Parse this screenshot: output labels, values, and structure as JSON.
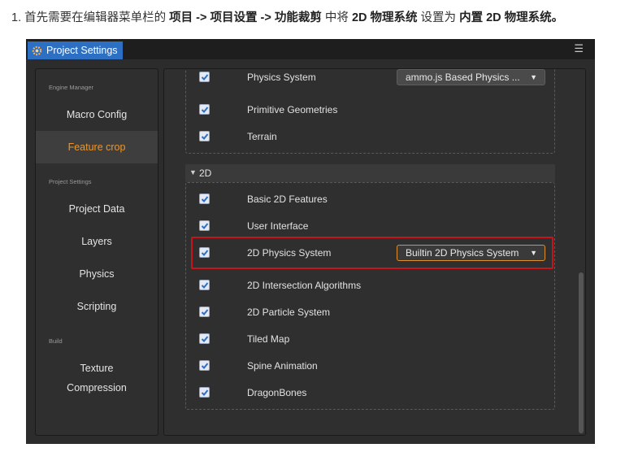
{
  "instruction": {
    "prefix": "1. 首先需要在编辑器菜单栏的 ",
    "menu_path": "项目 -> 项目设置 -> 功能裁剪",
    "middle": " 中将 ",
    "target": "2D 物理系统",
    "middle2": " 设置为 ",
    "value": "内置 2D 物理系统。"
  },
  "window": {
    "title": "Project Settings",
    "menu_icon": "hamburger-menu-icon"
  },
  "sidebar": {
    "engine_manager_header": "Engine Manager",
    "project_settings_header": "Project Settings",
    "build_header": "Build",
    "items": {
      "macro_config": "Macro Config",
      "feature_crop": "Feature crop",
      "project_data": "Project Data",
      "layers": "Layers",
      "physics": "Physics",
      "scripting": "Scripting",
      "texture": "Texture",
      "compression": "Compression"
    }
  },
  "features_3d": [
    {
      "label": "Physics System",
      "checked": true,
      "select": "ammo.js Based Physics ..."
    },
    {
      "label": "Primitive Geometries",
      "checked": true
    },
    {
      "label": "Terrain",
      "checked": true
    }
  ],
  "section_2d": {
    "label": "2D",
    "expanded": true
  },
  "features_2d": [
    {
      "label": "Basic 2D Features",
      "checked": true
    },
    {
      "label": "User Interface",
      "checked": true
    },
    {
      "label": "2D Physics System",
      "checked": true,
      "select": "Builtin 2D Physics System"
    },
    {
      "label": "2D Intersection Algorithms",
      "checked": true
    },
    {
      "label": "2D Particle System",
      "checked": true
    },
    {
      "label": "Tiled Map",
      "checked": true
    },
    {
      "label": "Spine Animation",
      "checked": true
    },
    {
      "label": "DragonBones",
      "checked": true
    }
  ],
  "colors": {
    "accent": "#e9972e",
    "title_tab": "#2d6fc3",
    "highlight": "#c8151b"
  }
}
